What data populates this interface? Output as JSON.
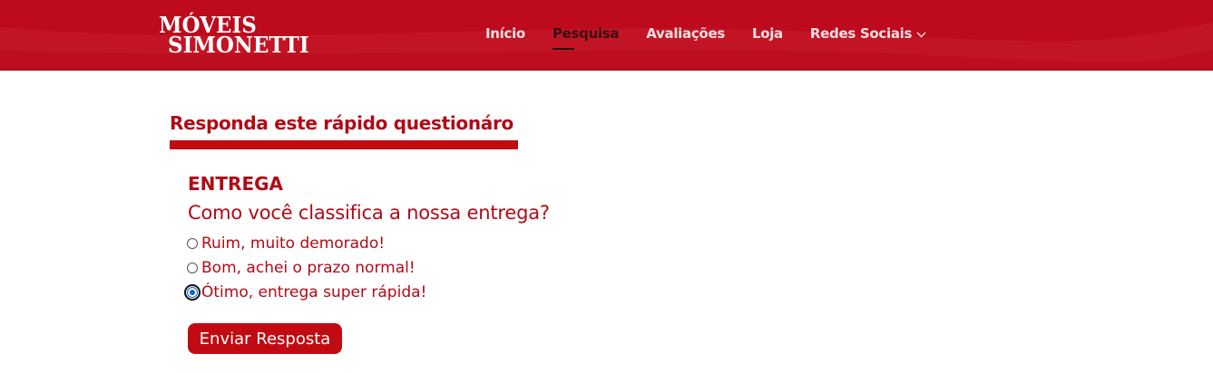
{
  "brand": {
    "line1": "MÓVEIS",
    "line2": "SIMONETTI"
  },
  "nav": {
    "items": [
      {
        "label": "Início"
      },
      {
        "label": "Pesquisa"
      },
      {
        "label": "Avaliações"
      },
      {
        "label": "Loja"
      },
      {
        "label": "Redes Sociais"
      }
    ],
    "active": "Pesquisa"
  },
  "survey": {
    "title": "Responda este rápido questionáro",
    "section": "ENTREGA",
    "question": "Como você classifica a nossa entrega?",
    "options": [
      {
        "label": "Ruim, muito demorado!",
        "checked": false
      },
      {
        "label": "Bom, achei o prazo normal!",
        "checked": false
      },
      {
        "label": "Ótimo, entrega super rápida!",
        "checked": true
      }
    ],
    "submit_label": "Enviar Resposta"
  },
  "colors": {
    "header_bg": "#bd0a1c",
    "accent": "#c10b13",
    "text_red": "#b10a16"
  }
}
